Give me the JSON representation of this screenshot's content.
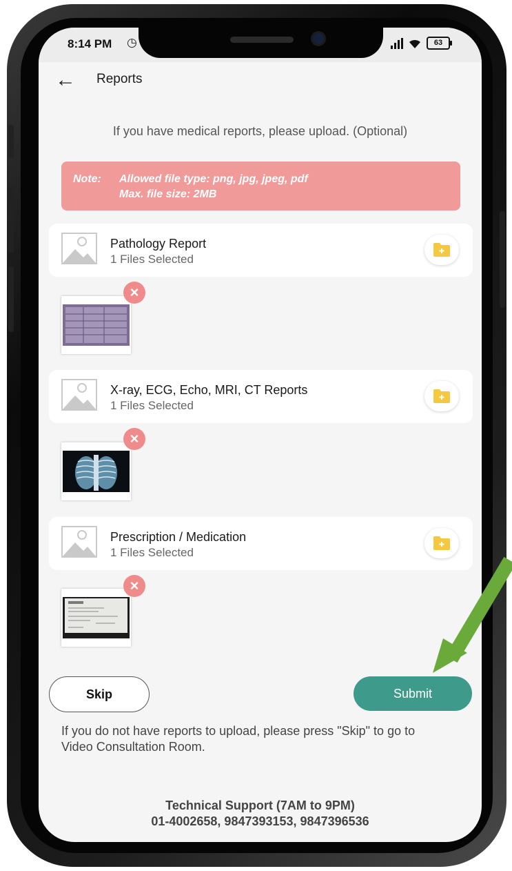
{
  "status_bar": {
    "time": "8:14 PM",
    "battery": "63"
  },
  "header": {
    "title": "Reports"
  },
  "intro_text": "If you have medical reports, please upload. (Optional)",
  "note": {
    "label": "Note:",
    "line1": "Allowed file type: png, jpg, jpeg, pdf",
    "line2": "Max. file size: 2MB"
  },
  "uploads": [
    {
      "title": "Pathology Report",
      "status": "1 Files Selected"
    },
    {
      "title": "X-ray, ECG, Echo, MRI, CT Reports",
      "status": "1 Files Selected"
    },
    {
      "title": "Prescription / Medication",
      "status": "1 Files Selected"
    }
  ],
  "buttons": {
    "skip": "Skip",
    "submit": "Submit"
  },
  "skip_info": "If you do not have reports to upload, please press \"Skip\" to go to Video Consultation Room.",
  "support": {
    "line1": "Technical Support (7AM to 9PM)",
    "line2": "01-4002658, 9847393153, 9847396536"
  },
  "colors": {
    "note_bg": "#f09a9a",
    "submit_bg": "#3e9b8b",
    "remove_bg": "#ef8b8b",
    "folder_icon": "#f5c842",
    "annotation_arrow": "#6aaa3a"
  },
  "icons": [
    "back-arrow-icon",
    "alarm-icon",
    "signal-icon",
    "wifi-icon",
    "battery-icon",
    "image-placeholder-icon",
    "folder-add-icon",
    "close-icon"
  ]
}
